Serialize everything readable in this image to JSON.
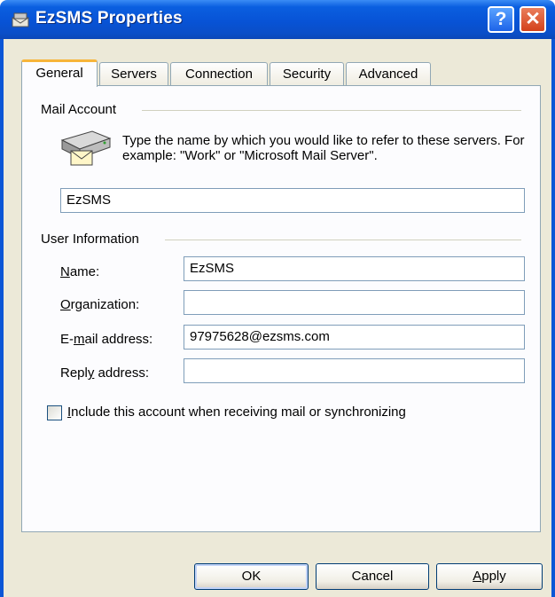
{
  "window": {
    "title": "EzSMS Properties",
    "help_btn": "?",
    "close_btn": "✕"
  },
  "tabs": [
    {
      "label": "General",
      "active": true
    },
    {
      "label": "Servers",
      "active": false
    },
    {
      "label": "Connection",
      "active": false
    },
    {
      "label": "Security",
      "active": false
    },
    {
      "label": "Advanced",
      "active": false
    }
  ],
  "mail_account": {
    "group_label": "Mail Account",
    "description": "Type the name by which you would like to refer to these servers.  For example: \"Work\" or \"Microsoft Mail Server\".",
    "account_name_value": "EzSMS"
  },
  "user_info": {
    "group_label": "User Information",
    "name_label_pre": "",
    "name_label_u": "N",
    "name_label_post": "ame:",
    "name_value": "EzSMS",
    "org_label_u": "O",
    "org_label_post": "rganization:",
    "org_value": "",
    "email_label_pre": "E-",
    "email_label_u": "m",
    "email_label_post": "ail address:",
    "email_value": "97975628@ezsms.com",
    "reply_label_pre": "Repl",
    "reply_label_u": "y",
    "reply_label_post": " address:",
    "reply_value": ""
  },
  "include_checkbox": {
    "label_u": "I",
    "label_post": "nclude this account when receiving mail or synchronizing",
    "checked": false
  },
  "buttons": {
    "ok": "OK",
    "cancel": "Cancel",
    "apply_u": "A",
    "apply_post": "pply"
  },
  "colors": {
    "titlebar": "#0853d6",
    "dialog_bg": "#ece9d8",
    "active_tab_accent": "#f7b53a"
  }
}
